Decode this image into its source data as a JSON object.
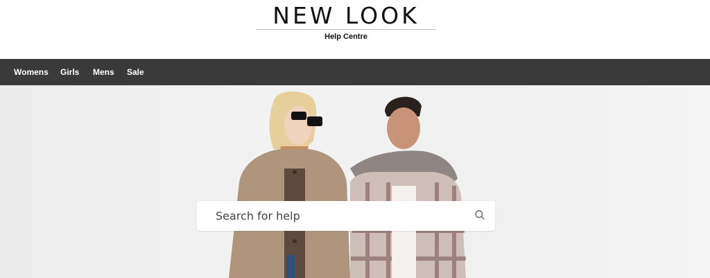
{
  "brand": {
    "logo_text": "NEW LOOK",
    "subtitle": "Help Centre"
  },
  "nav": {
    "items": [
      {
        "label": "Womens"
      },
      {
        "label": "Girls"
      },
      {
        "label": "Mens"
      },
      {
        "label": "Sale"
      }
    ]
  },
  "search": {
    "value": "",
    "placeholder": "Search for help",
    "icon": "search-icon"
  },
  "colors": {
    "nav_background": "#3a3a3a",
    "nav_text": "#ffffff",
    "hero_background": "#efefef",
    "brand_text": "#111111"
  }
}
